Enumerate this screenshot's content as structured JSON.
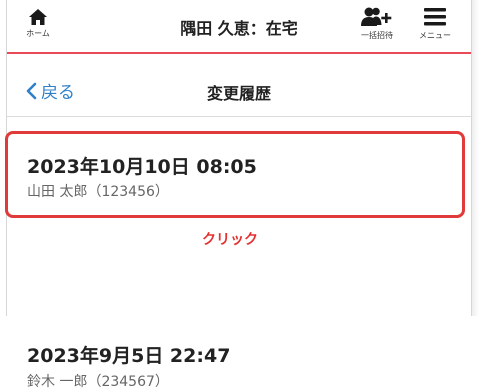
{
  "header": {
    "home_label": "ホーム",
    "title": "隅田 久恵：在宅",
    "bulk_invite_label": "一括招待",
    "menu_label": "メニュー",
    "accent_color": "#e84a57"
  },
  "subnav": {
    "back_label": "戻る",
    "page_title": "変更履歴",
    "link_color": "#2f7fc9"
  },
  "history": [
    {
      "date": "2023年10月10日 08:05",
      "user": "山田 太郎（123456）"
    },
    {
      "date": "2023年9月5日 22:47",
      "user": "鈴木 一郎（234567）"
    }
  ],
  "annotation": {
    "click_label": "クリック",
    "color": "#e03a3a"
  }
}
